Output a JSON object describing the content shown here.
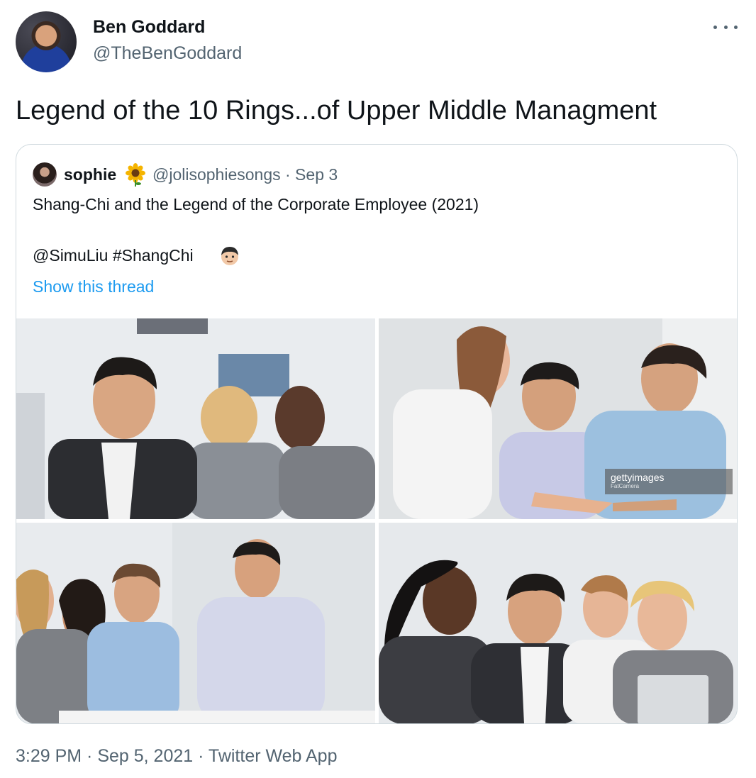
{
  "author": {
    "name": "Ben Goddard",
    "handle": "@TheBenGoddard"
  },
  "tweet": {
    "text": "Legend of the 10 Rings...of Upper Middle Managment",
    "timestamp": "3:29 PM · Sep 5, 2021 · Twitter Web App"
  },
  "quote": {
    "name": "sophie",
    "name_emoji": "sunflower-icon",
    "meta": "@jolisophiesongs · Sep 3",
    "line1": "Shang-Chi and the Legend of the Corporate Employee (2021)",
    "line2": "@SimuLiu #ShangChi",
    "line2_emoji": "man-face-icon",
    "show_thread": "Show this thread",
    "watermark": "gettyimages",
    "watermark_sub": "FatCamera"
  },
  "colors": {
    "link": "#1d9bf0",
    "secondary_text": "#536471",
    "border": "#cfd9de"
  }
}
